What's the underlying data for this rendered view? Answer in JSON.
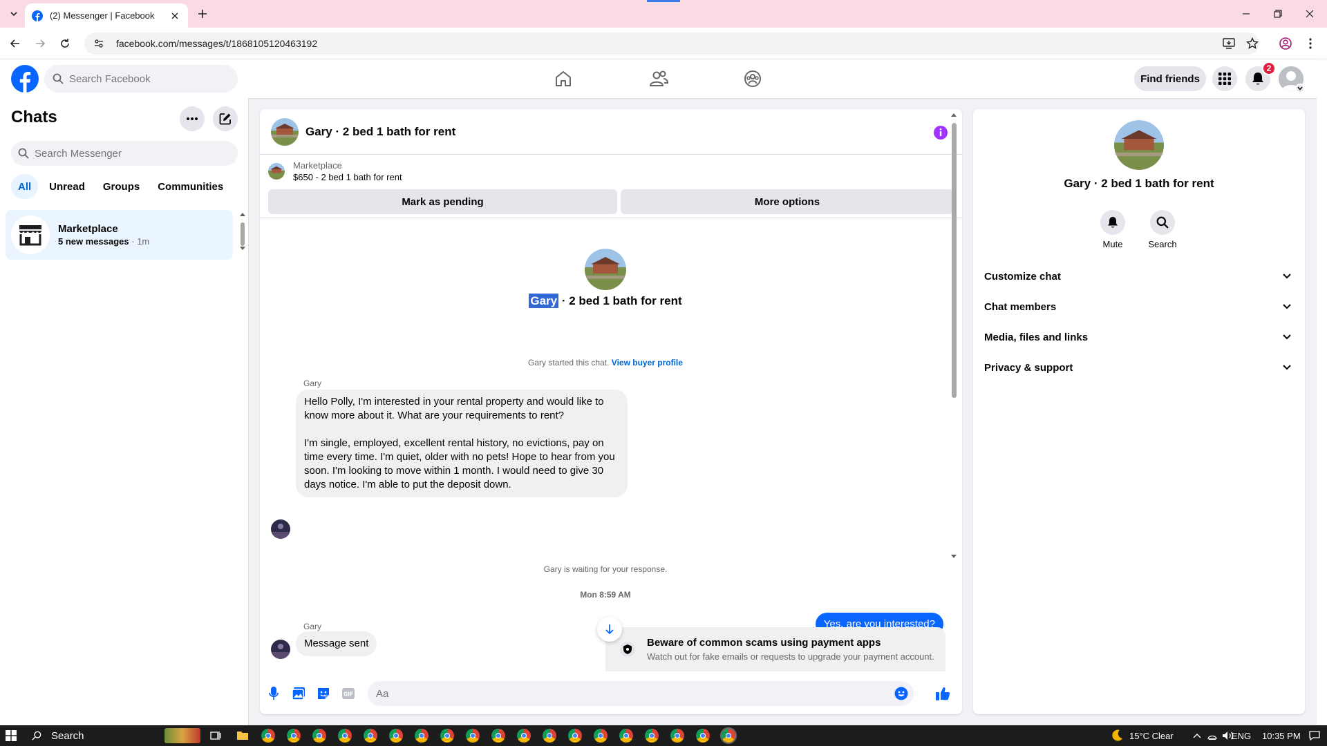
{
  "browser": {
    "tab_title": "(2) Messenger | Facebook",
    "url": "facebook.com/messages/t/1868105120463192"
  },
  "header": {
    "search_placeholder": "Search Facebook",
    "find_friends": "Find friends",
    "notification_count": "2"
  },
  "chats": {
    "title": "Chats",
    "search_placeholder": "Search Messenger",
    "filters": [
      "All",
      "Unread",
      "Groups",
      "Communities"
    ],
    "items": [
      {
        "name": "Marketplace",
        "preview": "5 new messages",
        "time": "· 1m"
      }
    ]
  },
  "conversation": {
    "title": "Gary · 2 bed 1 bath for rent",
    "marketplace_label": "Marketplace",
    "listing": "$650 - 2 bed 1 bath for rent",
    "mark_pending": "Mark as pending",
    "more_options": "More options",
    "profile_name_highlight": "Gary",
    "profile_name_rest": " · 2 bed 1 bath for rent",
    "started_text": "Gary started this chat.",
    "view_buyer_profile": "View buyer profile",
    "messages": [
      {
        "sender": "Gary",
        "paragraphs": [
          "Hello Polly,  I'm interested in your rental property and would like to know more about it. What are your requirements to rent?",
          "I'm single, employed, excellent rental history, no evictions, pay on time every time. I'm quiet, older with no pets!  Hope to hear from you soon. I'm looking to move within 1 month. I would need to give 30 days notice. I'm able to put the deposit down."
        ]
      },
      {
        "sender": "Gary",
        "paragraphs": [
          "Message sent"
        ]
      }
    ],
    "waiting_text": "Gary is waiting for your response.",
    "date_divider": "Mon 8:59 AM",
    "outgoing": "Yes, are you interested?",
    "scam_title": "Beware of common scams using payment apps",
    "scam_sub": "Watch out for fake emails or requests to upgrade your payment account.",
    "composer_placeholder": "Aa"
  },
  "info_panel": {
    "name": "Gary · 2 bed 1 bath for rent",
    "actions": [
      "Mute",
      "Search"
    ],
    "sections": [
      "Customize chat",
      "Chat members",
      "Media, files and links",
      "Privacy & support"
    ]
  },
  "taskbar": {
    "search_label": "Search",
    "weather": "15°C  Clear",
    "language": "ENG",
    "time": "10:35 PM"
  },
  "colors": {
    "fb_blue": "#0866ff",
    "active_chat_bg": "#ebf5ff",
    "info_purple": "#a033ff",
    "badge_red": "#e41e3f"
  }
}
